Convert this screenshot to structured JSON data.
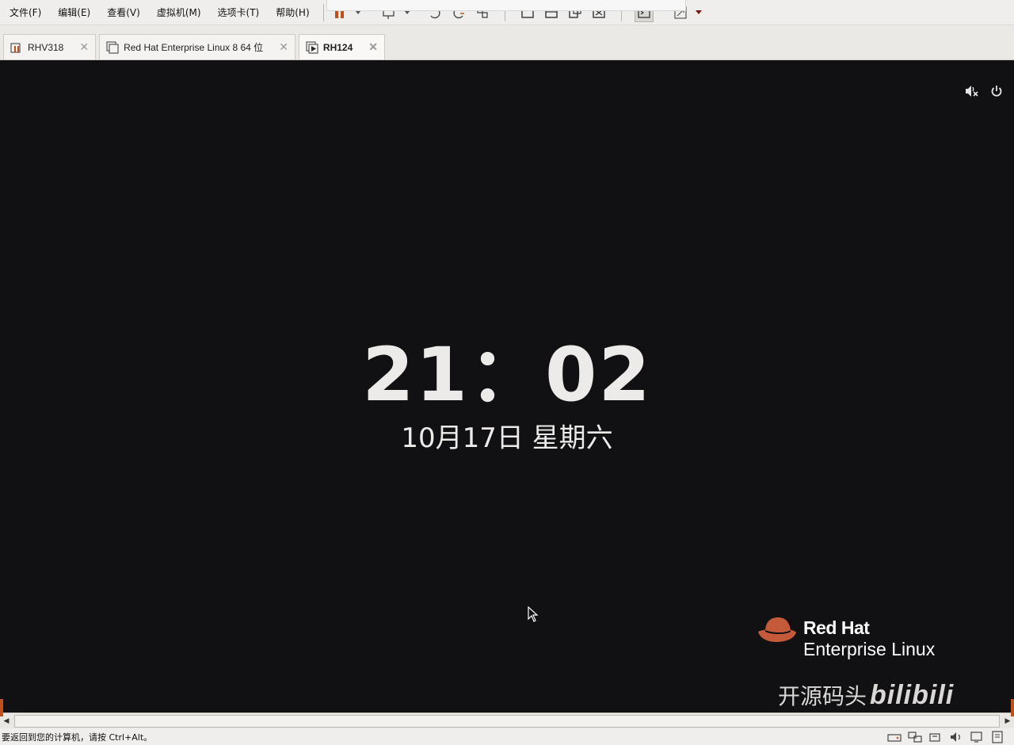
{
  "menubar": {
    "items": [
      "文件(F)",
      "编辑(E)",
      "查看(V)",
      "虚拟机(M)",
      "选项卡(T)",
      "帮助(H)"
    ]
  },
  "toolbar": {
    "icons": [
      "pause-icon",
      "send-keys-icon",
      "snapshot-icon",
      "revert-snapshot-icon",
      "snapshot-manager-icon",
      "full-screen-icon",
      "console-view-icon",
      "unity-icon",
      "stretch-icon",
      "terminal-icon",
      "fit-window-icon"
    ]
  },
  "tabs": [
    {
      "label": "RHV318",
      "icon": "vm-paused-icon",
      "active": false
    },
    {
      "label": "Red Hat Enterprise Linux 8 64 位",
      "icon": "vm-off-icon",
      "active": false
    },
    {
      "label": "RH124",
      "icon": "vm-running-icon",
      "active": true
    }
  ],
  "guest": {
    "time": "21：02",
    "date": "10月17日 星期六",
    "logo_brand": "Red Hat",
    "logo_product": "Enterprise Linux",
    "watermark_text": "开源码头",
    "watermark_brand": "bilibili"
  },
  "status": {
    "text": "要返回到您的计算机，请按 Ctrl+Alt。"
  },
  "colors": {
    "guest_bg": "#111012",
    "chrome_bg": "#efeeec",
    "redhat_red": "#c45a3a"
  }
}
